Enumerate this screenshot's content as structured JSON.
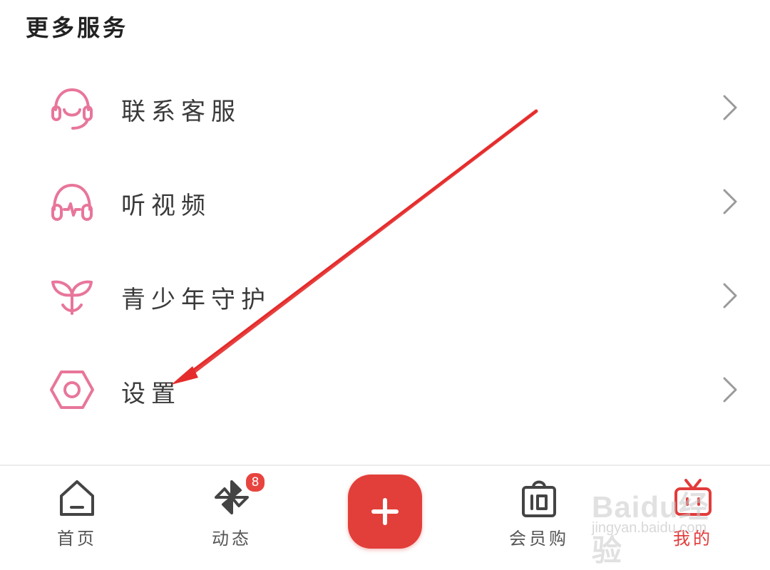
{
  "section": {
    "title": "更多服务"
  },
  "menu": {
    "items": [
      {
        "label": "联系客服",
        "icon": "headset-icon"
      },
      {
        "label": "听视频",
        "icon": "headphones-icon"
      },
      {
        "label": "青少年守护",
        "icon": "sprout-icon"
      },
      {
        "label": "设置",
        "icon": "settings-hexagon-icon"
      }
    ]
  },
  "tabbar": {
    "tabs": [
      {
        "label": "首页",
        "icon": "home-icon",
        "active": false
      },
      {
        "label": "动态",
        "icon": "pinwheel-icon",
        "active": false,
        "badge": "8"
      },
      {
        "label": "",
        "icon": "plus-icon",
        "active": false
      },
      {
        "label": "会员购",
        "icon": "shopping-bag-icon",
        "active": false
      },
      {
        "label": "我的",
        "icon": "tv-icon",
        "active": true
      }
    ]
  },
  "watermark": {
    "brand": "Baidu经验",
    "url": "jingyan.baidu.com"
  },
  "colors": {
    "accent_pink": "#e8769a",
    "accent_red": "#e23f3a",
    "annotation_arrow": "#e52b2b"
  }
}
